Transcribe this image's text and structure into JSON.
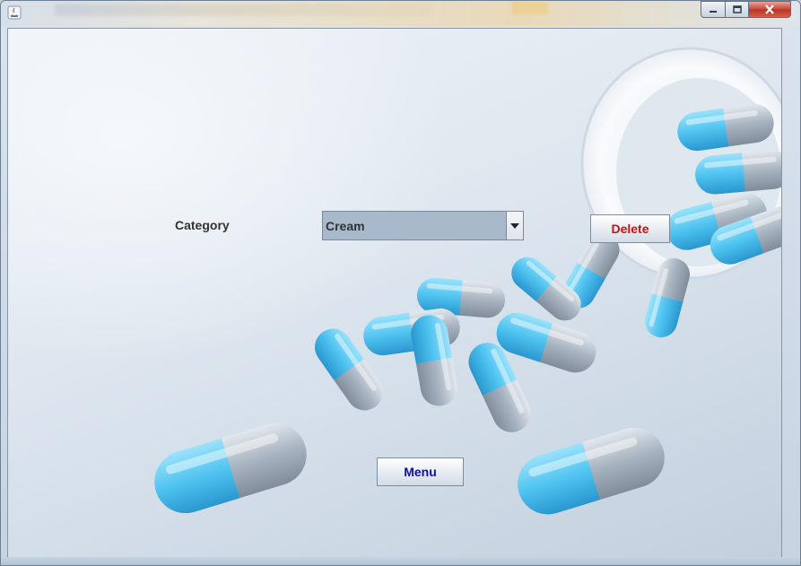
{
  "window": {
    "controls": {
      "minimize_icon": "minimize-icon",
      "maximize_icon": "maximize-icon",
      "close_icon": "close-icon"
    }
  },
  "form": {
    "category_label": "Category",
    "category_select": {
      "value": "Cream"
    },
    "delete_label": "Delete",
    "menu_label": "Menu"
  },
  "colors": {
    "delete_text": "#cc1010",
    "menu_text": "#1010a0",
    "combo_bg": "#a9b9cc",
    "capsule_blue": "#4fc3f0",
    "capsule_grey": "#a7b3c0"
  }
}
